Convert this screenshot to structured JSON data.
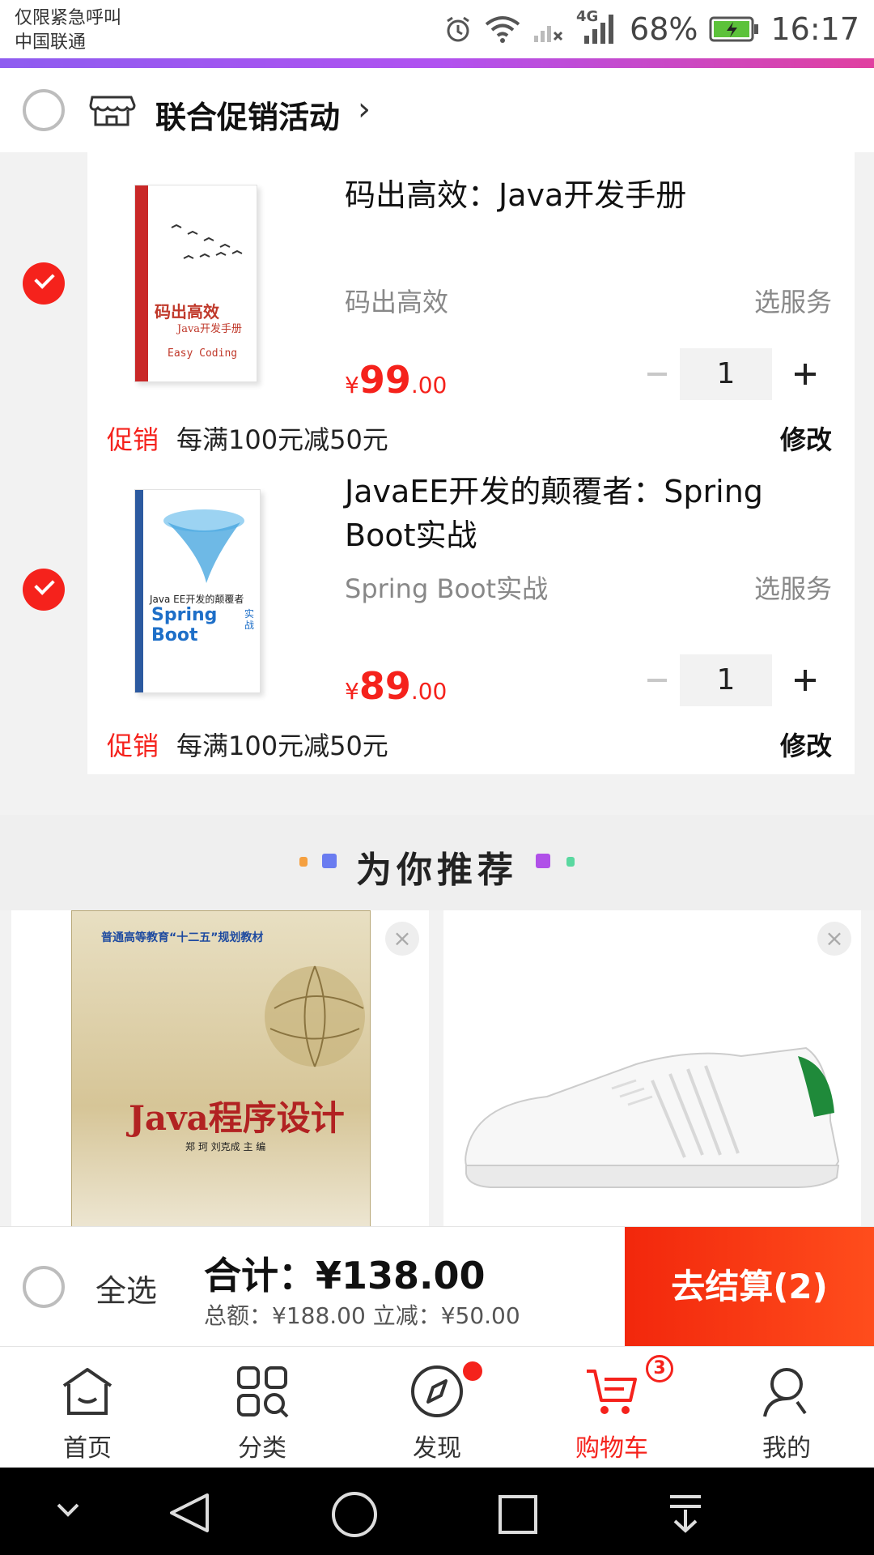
{
  "status_bar": {
    "carrier_line1": "仅限紧急呼叫",
    "carrier_line2": "中国联通",
    "network": "4G",
    "battery_pct": "68%",
    "time": "16:17"
  },
  "promo_group": {
    "title": "联合促销活动",
    "chevron": "›",
    "icon": "store-icon"
  },
  "cart_items": [
    {
      "name": "码出高效：Java开发手册",
      "subtitle": "码出高效",
      "service": "选服务",
      "price_currency": "¥",
      "price_int": "99",
      "price_dec": ".00",
      "qty": "1",
      "promo_tag": "促销",
      "promo_desc": "每满100元减50元",
      "modify": "修改",
      "checked": true,
      "cover_title": "码出高效",
      "cover_subtitle": "Java开发手册",
      "cover_footer": "Easy Coding"
    },
    {
      "name": "JavaEE开发的颠覆者：Spring Boot实战",
      "subtitle": "Spring Boot实战",
      "service": "选服务",
      "price_currency": "¥",
      "price_int": "89",
      "price_dec": ".00",
      "qty": "1",
      "promo_tag": "促销",
      "promo_desc": "每满100元减50元",
      "modify": "修改",
      "checked": true,
      "cover_title": "Java EE开发的颠覆者",
      "cover_subtitle": "Spring Boot",
      "cover_badge": "实战"
    }
  ],
  "recommend": {
    "title": "为你推荐",
    "cards": [
      {
        "cover_title": "Java程序设计",
        "cover_series": "普通高等教育“十二五”规划教材",
        "cover_authors": "郑 珂  刘克成  主 编",
        "close": "×"
      },
      {
        "image": "white-sneaker",
        "close": "×"
      }
    ]
  },
  "action_bar": {
    "select_all": "全选",
    "total": "合计：¥138.00",
    "subtotal": "总额：¥188.00 立减：¥50.00",
    "checkout": "去结算(2)"
  },
  "tabs": [
    {
      "label": "首页",
      "icon": "home-icon"
    },
    {
      "label": "分类",
      "icon": "category-icon"
    },
    {
      "label": "发现",
      "icon": "compass-icon"
    },
    {
      "label": "购物车",
      "icon": "cart-icon",
      "badge": "3",
      "active": true
    },
    {
      "label": "我的",
      "icon": "profile-icon"
    }
  ],
  "colors": {
    "accent_red": "#f5221c",
    "checkout_red": "#f2270c",
    "accent_purple": "#8e5cf0"
  }
}
